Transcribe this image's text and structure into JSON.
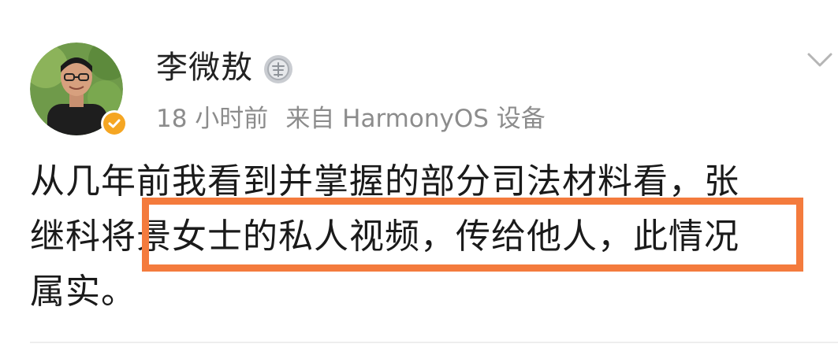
{
  "post": {
    "author": {
      "name": "李微敖",
      "avatar_icon": "avatar-photo",
      "verified_icon": "verified-badge-icon",
      "verified_color": "#f5a623",
      "medal_icon": "silver-medal-icon"
    },
    "meta": {
      "time": "18 小时前",
      "source": "来自 HarmonyOS 设备"
    },
    "menu_icon": "chevron-down-icon",
    "content_lines": [
      "从几年前我看到并掌握的部分司法材料看，张",
      "继科将景女士的私人视频，传给他人，此情况",
      "属实。"
    ],
    "highlight_color": "#f47b3d"
  }
}
